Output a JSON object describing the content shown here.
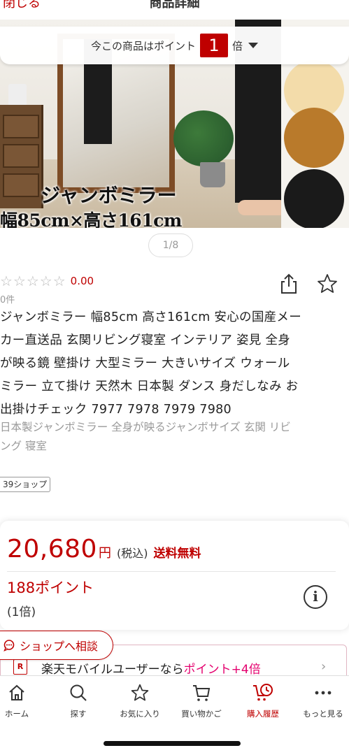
{
  "header": {
    "close_label": "閉じる",
    "title": "商品詳細"
  },
  "points_banner": {
    "prefix": "今この商品はポイント",
    "multiplier": "1",
    "suffix": "倍"
  },
  "hero": {
    "caption_line1": "ジャンボミラー",
    "caption_line2": "幅85cm×高さ161cm",
    "swatch_colors": [
      "#f3dcaa",
      "#b97a2b",
      "#1a1a1a"
    ]
  },
  "pager": {
    "text": "1/8"
  },
  "rating": {
    "stars": "☆☆☆☆☆",
    "score": "0.00",
    "review_count": "0件"
  },
  "product": {
    "title": "ジャンボミラー 幅85cm 高さ161cm 安心の国産メー\nカー直送品 玄関リビング寝室 インテリア 姿見 全身\nが映る鏡 壁掛け 大型ミラー 大きいサイズ ウォール\nミラー 立て掛け 天然木 日本製 ダンス 身だしなみ お\n出掛けチェック 7977 7978 7979 7980",
    "catch_copy": "日本製ジャンボミラー 全身が映るジャンボサイズ 玄関 リビ\nング 寝室",
    "shop_tag": "39ショップ"
  },
  "price": {
    "amount": "20,680",
    "currency": "円",
    "tax_note": "(税込)",
    "shipping": "送料無料",
    "points": "188ポイント",
    "points_multiplier": "(1倍)",
    "info_icon": "i"
  },
  "consult": {
    "label": "ショップへ相談"
  },
  "mobile_banner": {
    "logo": "R",
    "text": "楽天モバイルユーザーなら",
    "accent": "ポイント+4倍"
  },
  "nav": {
    "items": [
      {
        "label": "ホーム",
        "icon": "home-icon"
      },
      {
        "label": "探す",
        "icon": "search-icon"
      },
      {
        "label": "お気に入り",
        "icon": "star-icon"
      },
      {
        "label": "買い物かご",
        "icon": "cart-icon"
      },
      {
        "label": "購入履歴",
        "icon": "purchase-history-icon"
      },
      {
        "label": "もっと見る",
        "icon": "more-icon"
      }
    ],
    "active_index": 4
  },
  "colors": {
    "accent_red": "#bf0000",
    "accent_pink": "#e4006e"
  }
}
